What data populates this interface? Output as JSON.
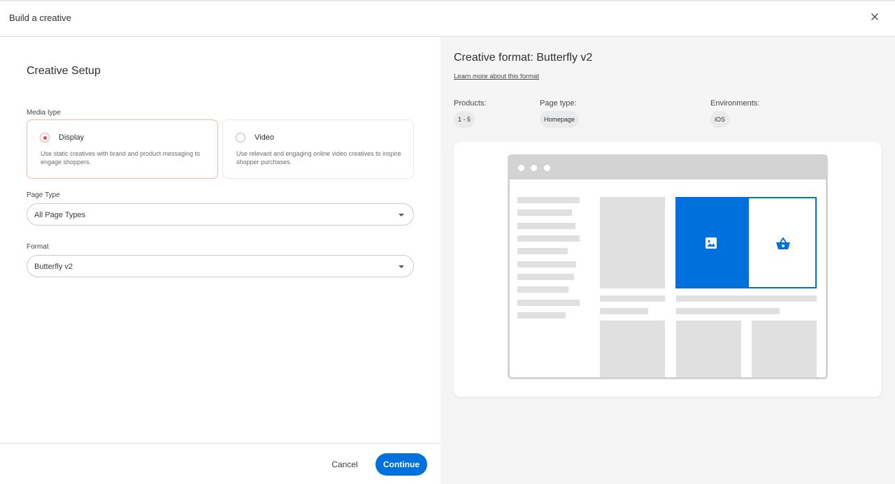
{
  "header": {
    "title": "Build a creative",
    "close_icon": "close-icon"
  },
  "setup": {
    "title": "Creative Setup",
    "media_type_label": "Media type",
    "media_options": [
      {
        "label": "Display",
        "description": "Use static creatives with brand and product messaging to engage shoppers.",
        "selected": true
      },
      {
        "label": "Video",
        "description": "Use relevant and engaging online video creatives to inspire shopper purchases.",
        "selected": false
      }
    ],
    "page_type_label": "Page Type",
    "page_type_value": "All Page Types",
    "format_label": "Format",
    "format_value": "Butterfly v2"
  },
  "footer": {
    "cancel_label": "Cancel",
    "continue_label": "Continue"
  },
  "format_info": {
    "title": "Creative format: Butterfly v2",
    "learn_more": "Learn more about this format",
    "products_label": "Products:",
    "products_value": "1 - 5",
    "page_type_label": "Page type:",
    "page_type_value": "Homepage",
    "environments_label": "Environments:",
    "environments_value": "iOS"
  },
  "colors": {
    "accent": "#0071dc",
    "selected_radio": "#e5493a",
    "selected_border": "#f1b8a8"
  },
  "icons": {
    "image": "image-icon",
    "basket": "basket-icon"
  }
}
